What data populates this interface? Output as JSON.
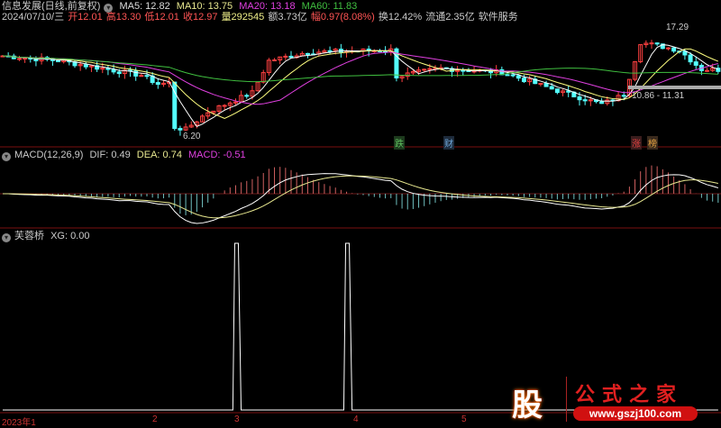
{
  "header": {
    "title": "信息发展(日线,前复权)",
    "ma5": "MA5: 12.82",
    "ma10": "MA10: 13.75",
    "ma20": "MA20: 13.18",
    "ma60": "MA60: 11.83",
    "date": "2024/07/10/三",
    "open": "开12.01",
    "high": "高13.30",
    "low": "低12.01",
    "close": "收12.97",
    "volume": "量292545",
    "amount": "额3.73亿",
    "change": "幅0.97(8.08%)",
    "turnover": "换12.42%",
    "float": "流通2.35亿",
    "sector": "软件服务"
  },
  "price_chart": {
    "high_label": "17.29",
    "low_label": "6.20",
    "range_label": "10.86 - 11.31",
    "keypoints": [
      [
        0,
        14.4
      ],
      [
        10,
        13.9
      ],
      [
        25,
        12.4
      ],
      [
        30,
        11.6
      ],
      [
        28,
        11.5
      ],
      [
        31,
        7.0
      ],
      [
        33,
        6.8
      ],
      [
        37,
        8.6
      ],
      [
        45,
        10.6
      ],
      [
        48,
        13.9
      ],
      [
        55,
        14.8
      ],
      [
        70,
        15.0
      ],
      [
        71,
        12.3
      ],
      [
        79,
        13.1
      ],
      [
        90,
        12.7
      ],
      [
        100,
        10.8
      ],
      [
        108,
        9.4
      ],
      [
        112,
        10.4
      ],
      [
        115,
        15.8
      ],
      [
        122,
        15.0
      ],
      [
        126,
        13.0
      ],
      [
        129,
        12.97
      ]
    ],
    "markers": [
      {
        "text": "跌",
        "color": "#5fbf5f"
      },
      {
        "text": "财",
        "color": "#6fa8dc"
      },
      {
        "text": "涨",
        "color": "#e04040"
      },
      {
        "text": "榜",
        "color": "#e0a040"
      }
    ]
  },
  "macd": {
    "title": "MACD(12,26,9)",
    "dif": "DIF: 0.49",
    "dea": "DEA: 0.74",
    "macd": "MACD: -0.51"
  },
  "xg": {
    "title": "芙蓉桥",
    "value": "XG: 0.00",
    "signals": [
      42,
      62
    ]
  },
  "axis": {
    "labels": [
      "2023年1",
      "2",
      "3",
      "4",
      "5"
    ]
  },
  "logo": {
    "char": "股",
    "name": "公式之家",
    "url": "www.gszj100.com"
  },
  "colors": {
    "up": "#ff4040",
    "down": "#54ffff",
    "ma5": "#ffffff",
    "ma10": "#ffff80",
    "ma20": "#e040e0",
    "ma60": "#40c040",
    "grid": "#7a1010"
  }
}
